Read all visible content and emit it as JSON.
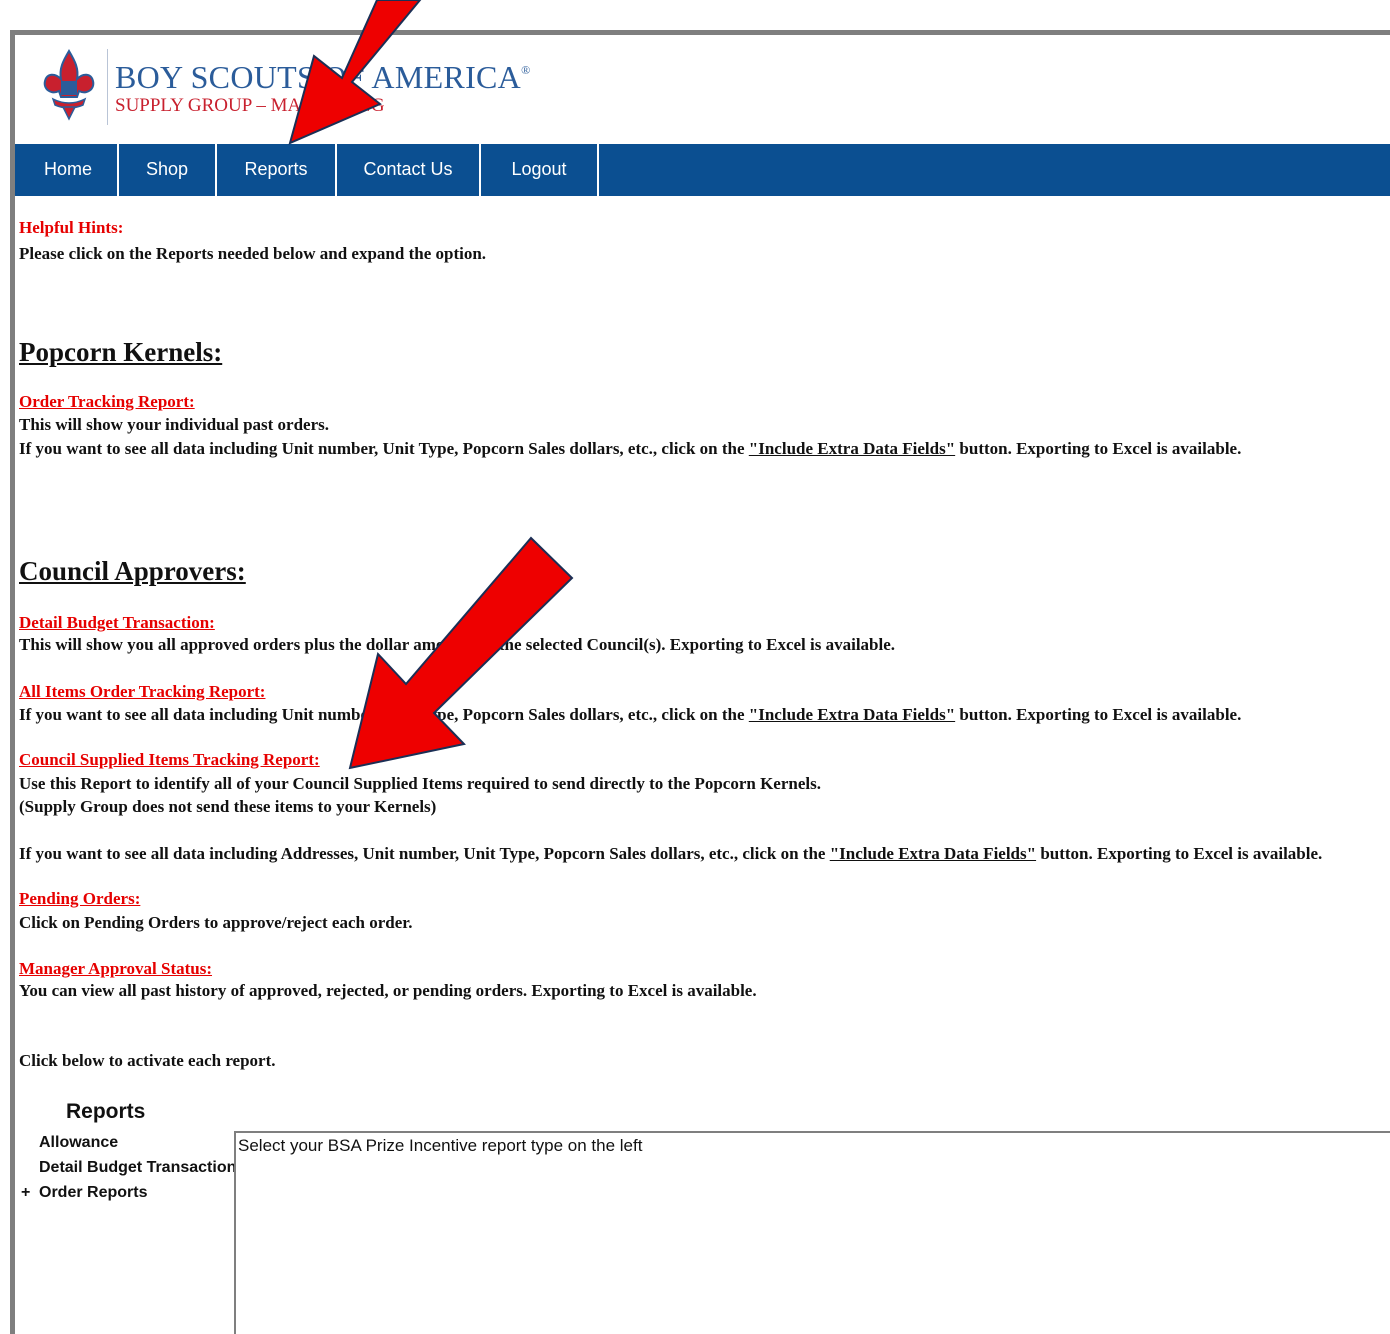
{
  "header": {
    "title": "BOY SCOUTS OF AMERICA",
    "title_mark": "®",
    "subtitle": "SUPPLY GROUP – MARKETING"
  },
  "nav": {
    "items": [
      {
        "label": "Home"
      },
      {
        "label": "Shop"
      },
      {
        "label": "Reports"
      },
      {
        "label": "Contact Us"
      },
      {
        "label": "Logout"
      }
    ]
  },
  "hints": {
    "title": "Helpful Hints:",
    "text": "Please click on the Reports needed below and expand the option."
  },
  "popcorn": {
    "heading": "Popcorn Kernels:",
    "order_tracking": {
      "link": "Order Tracking Report:",
      "line1": "This will show your individual past orders.",
      "line2_pre": "If you want to see all data including Unit number, Unit Type, Popcorn Sales dollars, etc., click on the ",
      "line2_button": "\"Include Extra Data Fields\"",
      "line2_post": " button. Exporting to Excel is available."
    }
  },
  "council": {
    "heading": "Council Approvers:",
    "detail_budget": {
      "link": "Detail Budget Transaction:",
      "line1": "This will show you all approved orders plus the dollar amount for the selected Council(s). Exporting to Excel is available."
    },
    "all_items": {
      "link": "All Items Order Tracking Report:",
      "line_pre": "If you want to see all data including Unit number, Unit Type, Popcorn Sales dollars, etc., click on the ",
      "line_button": "\"Include Extra Data Fields\"",
      "line_post": " button. Exporting to Excel is available."
    },
    "council_supplied": {
      "link": "Council Supplied Items Tracking Report:",
      "line1": "Use this Report to identify all of your Council Supplied Items required to send directly to the Popcorn Kernels.",
      "line2": "(Supply Group does not send these items to your Kernels)",
      "line3_pre": "If you want to see all data including Addresses, Unit number, Unit Type, Popcorn Sales dollars, etc., click on the ",
      "line3_button": "\"Include Extra Data Fields\"",
      "line3_post": " button. Exporting to Excel is available."
    },
    "pending": {
      "link": "Pending Orders:",
      "line1": "Click on Pending Orders to approve/reject each order."
    },
    "manager": {
      "link": "Manager Approval Status:",
      "line1": "You can view all past history of approved, rejected, or pending orders. Exporting to Excel is available."
    }
  },
  "activate": "Click below to activate each report.",
  "reports_panel": {
    "title": "Reports",
    "tree": [
      {
        "prefix": "",
        "label": "Allowance"
      },
      {
        "prefix": "",
        "label": "Detail Budget Transaction"
      },
      {
        "prefix": "+",
        "label": "Order Reports"
      }
    ],
    "message": "Select your BSA Prize Incentive report type on the left"
  },
  "colors": {
    "nav_bg": "#0b4f91",
    "link_red": "#e60000",
    "arrow_red": "#ee0000",
    "brand_blue": "#2b5c9a",
    "brand_red": "#c8202e"
  },
  "icons": [
    "fleur-de-lis-icon",
    "red-arrow-icon"
  ]
}
